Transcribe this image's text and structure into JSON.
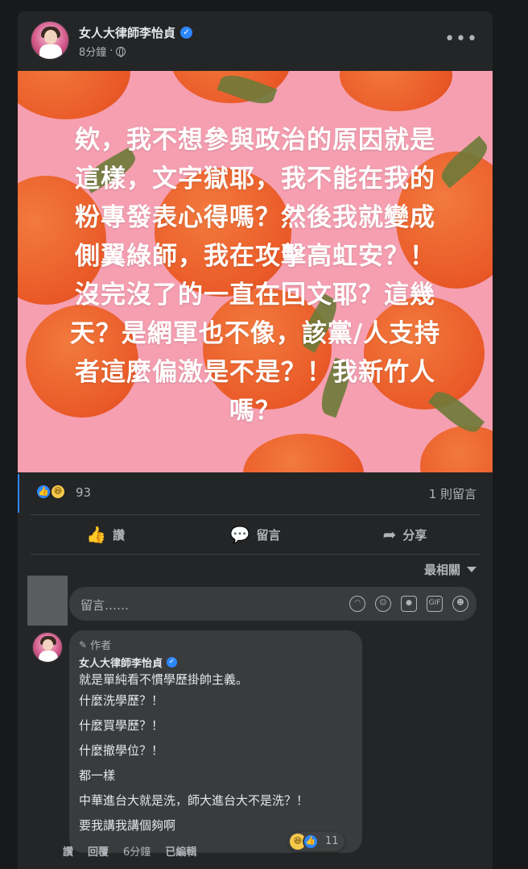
{
  "post": {
    "author": "女人大律師李怡貞",
    "verified_glyph": "✓",
    "time": "8分鐘",
    "separator": "·",
    "more": "•••",
    "image_text_lines": [
      "欸，我不想參與政治的原因就是",
      "這樣，文字獄耶，我不能在我的",
      "粉專發表心得嗎？然後我就變成",
      "側翼綠師，我在攻擊高虹安？！",
      "沒完沒了的一直在回文耶？這幾",
      "天？是網軍也不像，該黨/人支持",
      "者這麼偏激是不是？！我新竹人",
      "嗎？"
    ],
    "background_color": "#f59fb1",
    "orange_color": "#ea5a28"
  },
  "stats": {
    "reaction_count": "93",
    "comment_count": "1 則留言"
  },
  "actions": {
    "like": "讚",
    "comment": "留言",
    "share": "分享"
  },
  "sort": {
    "label": "最相關"
  },
  "composer": {
    "placeholder": "留言……",
    "icons": [
      "sticker-icon",
      "emoji-icon",
      "camera-icon",
      "gif-icon",
      "avatar-sticker-icon"
    ]
  },
  "comment": {
    "tag": "作者",
    "author": "女人大律師李怡貞",
    "lines": [
      "就是單純看不慣學歷掛帥主義。",
      "什麼洗學歷？！",
      "什麼買學歷？！",
      "什麼撤學位？！",
      "都一樣",
      "中華進台大就是洗，師大進台大不是洗？！",
      "要我講我講個夠啊"
    ],
    "reaction_count": "11",
    "like": "讚",
    "reply": "回覆",
    "time": "6分鐘",
    "edited": "已編輯"
  },
  "colors": {
    "background": "#18191a",
    "card": "#242526",
    "accent": "#2d88ff",
    "text_secondary": "#b0b3b8"
  }
}
